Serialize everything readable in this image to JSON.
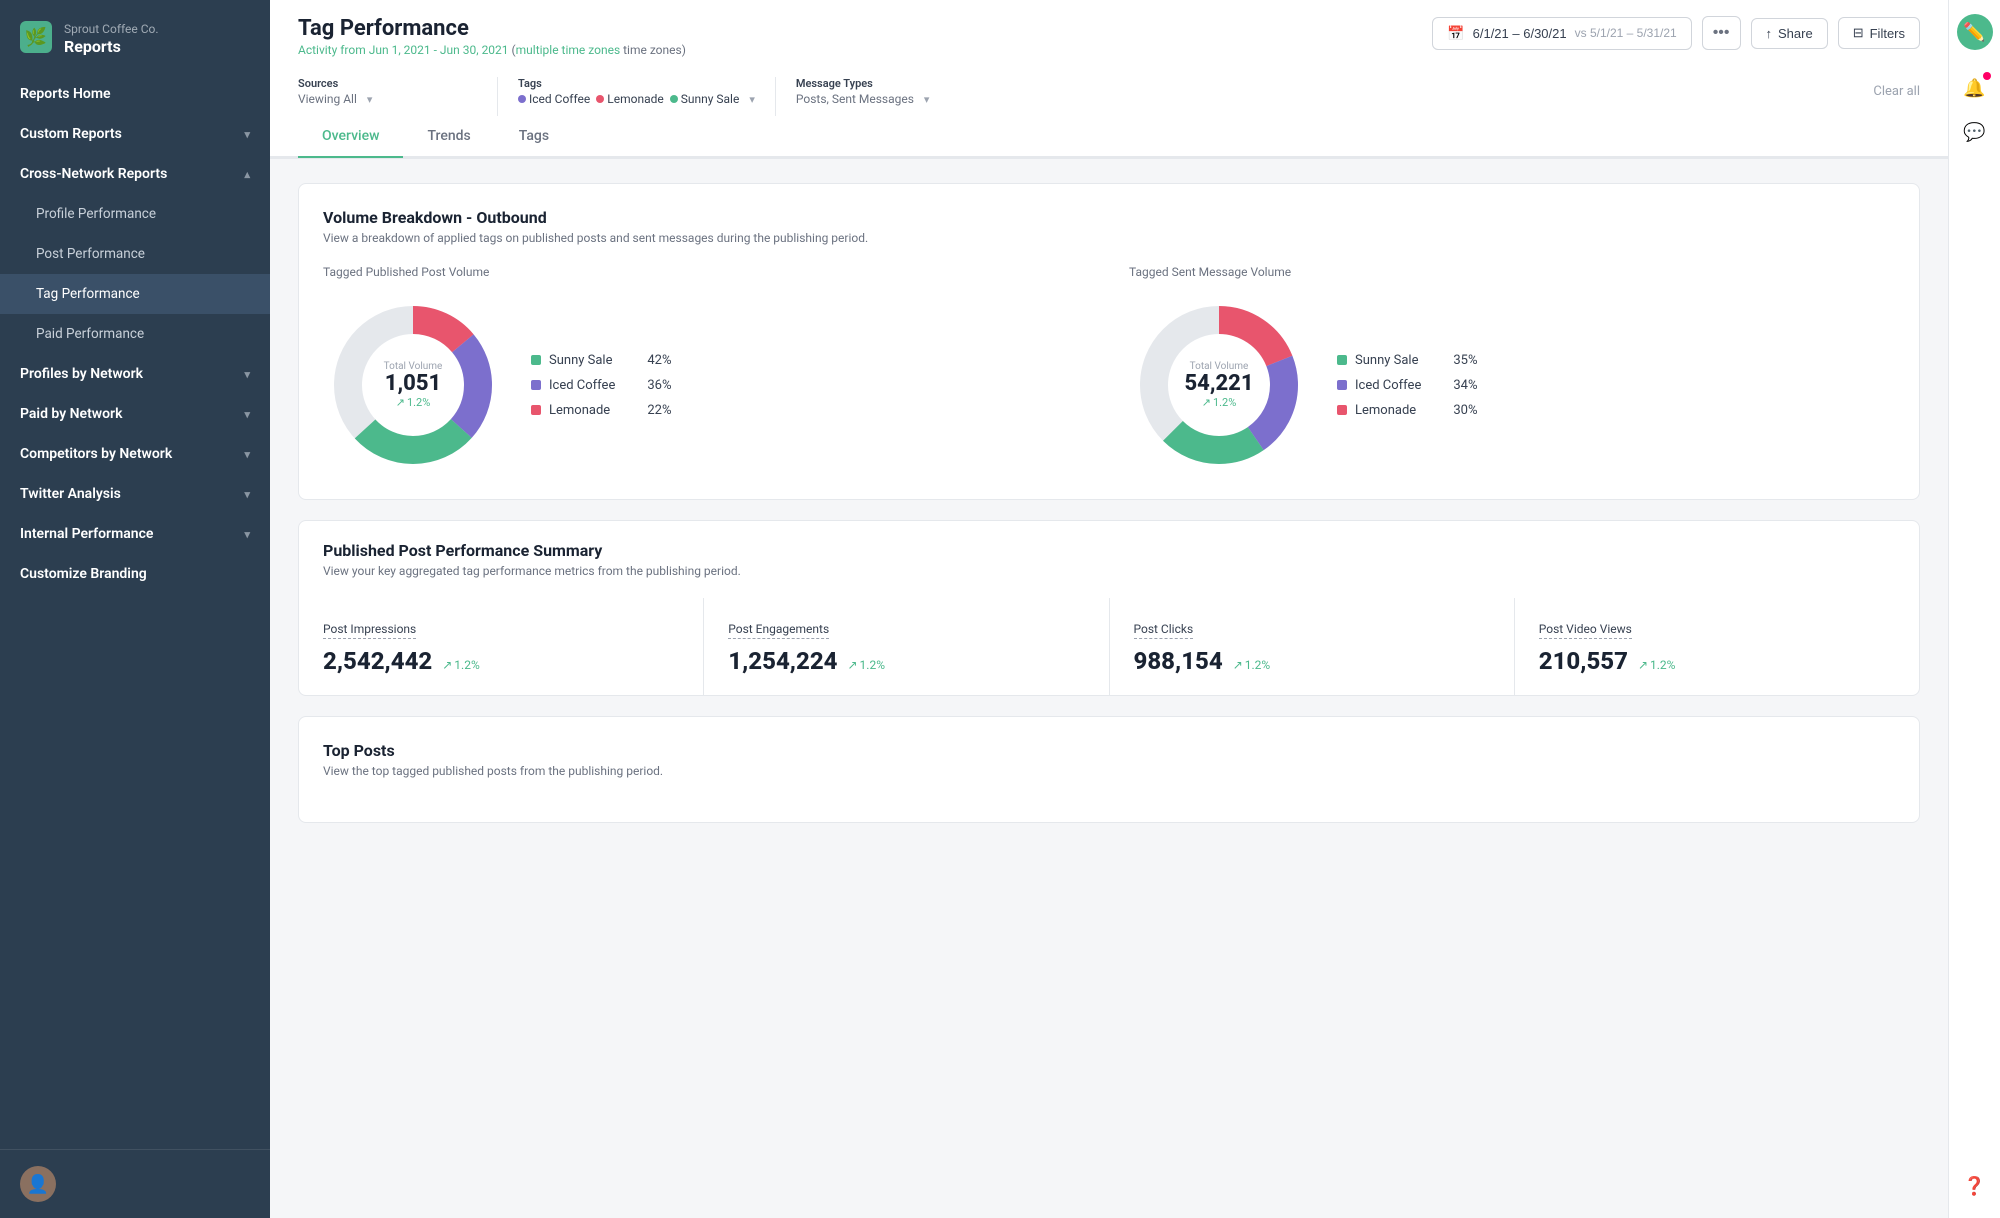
{
  "brand": {
    "company": "Sprout Coffee Co.",
    "app": "Reports"
  },
  "sidebar": {
    "nav": [
      {
        "id": "reports-home",
        "label": "Reports Home",
        "level": "top",
        "active": false
      },
      {
        "id": "custom-reports",
        "label": "Custom Reports",
        "level": "top",
        "hasChevron": true,
        "active": false
      },
      {
        "id": "cross-network",
        "label": "Cross-Network Reports",
        "level": "top",
        "hasChevron": true,
        "expanded": true,
        "active": false
      },
      {
        "id": "profile-performance",
        "label": "Profile Performance",
        "level": "sub",
        "active": false
      },
      {
        "id": "post-performance",
        "label": "Post Performance",
        "level": "sub",
        "active": false
      },
      {
        "id": "tag-performance",
        "label": "Tag Performance",
        "level": "sub",
        "active": true
      },
      {
        "id": "paid-performance",
        "label": "Paid Performance",
        "level": "sub",
        "active": false
      },
      {
        "id": "profiles-by-network",
        "label": "Profiles by Network",
        "level": "top",
        "hasChevron": true,
        "active": false
      },
      {
        "id": "paid-by-network",
        "label": "Paid by Network",
        "level": "top",
        "hasChevron": true,
        "active": false
      },
      {
        "id": "competitors-by-network",
        "label": "Competitors by Network",
        "level": "top",
        "hasChevron": true,
        "active": false
      },
      {
        "id": "twitter-analysis",
        "label": "Twitter Analysis",
        "level": "top",
        "hasChevron": true,
        "active": false
      },
      {
        "id": "internal-performance",
        "label": "Internal Performance",
        "level": "top",
        "hasChevron": true,
        "active": false
      },
      {
        "id": "customize-branding",
        "label": "Customize Branding",
        "level": "top",
        "active": false
      }
    ]
  },
  "header": {
    "title": "Tag Performance",
    "subtitle": "Activity from Jun 1, 2021 - Jun 30, 2021",
    "timezoneNote": "multiple time zones",
    "dateRange": "6/1/21 – 6/30/21",
    "compareRange": "vs 5/1/21 – 5/31/21",
    "actions": {
      "share": "Share",
      "filters": "Filters"
    }
  },
  "filtersBar": {
    "sources": {
      "label": "Sources",
      "value": "Viewing All"
    },
    "tags": {
      "label": "Tags",
      "items": [
        {
          "name": "Iced Coffee",
          "color": "#7c6fcd"
        },
        {
          "name": "Lemonade",
          "color": "#e8556d"
        },
        {
          "name": "Sunny Sale",
          "color": "#4cb98c"
        }
      ]
    },
    "messageTypes": {
      "label": "Message Types",
      "value": "Posts, Sent Messages"
    },
    "clearAll": "Clear all"
  },
  "tabs": [
    {
      "id": "overview",
      "label": "Overview",
      "active": true
    },
    {
      "id": "trends",
      "label": "Trends",
      "active": false
    },
    {
      "id": "tags",
      "label": "Tags",
      "active": false
    }
  ],
  "volumeBreakdown": {
    "title": "Volume Breakdown - Outbound",
    "subtitle": "View a breakdown of applied tags on published posts and sent messages during the publishing period.",
    "publishedChart": {
      "label": "Tagged Published Post Volume",
      "totalLabel": "Total Volume",
      "totalValue": "1,051",
      "change": "1.2%",
      "segments": [
        {
          "label": "Sunny Sale",
          "color": "#4cb98c",
          "pct": 42,
          "degrees": 151.2
        },
        {
          "label": "Iced Coffee",
          "color": "#7c6fcd",
          "pct": 36,
          "degrees": 129.6
        },
        {
          "label": "Lemonade",
          "color": "#e8556d",
          "pct": 22,
          "degrees": 79.2
        }
      ]
    },
    "sentChart": {
      "label": "Tagged Sent Message Volume",
      "totalLabel": "Total Volume",
      "totalValue": "54,221",
      "change": "1.2%",
      "segments": [
        {
          "label": "Sunny Sale",
          "color": "#4cb98c",
          "pct": 35,
          "degrees": 126
        },
        {
          "label": "Iced Coffee",
          "color": "#7c6fcd",
          "pct": 34,
          "degrees": 122.4
        },
        {
          "label": "Lemonade",
          "color": "#e8556d",
          "pct": 30,
          "degrees": 108
        }
      ]
    }
  },
  "postPerformance": {
    "title": "Published Post Performance Summary",
    "subtitle": "View your key aggregated tag performance metrics from the publishing period.",
    "stats": [
      {
        "id": "post-impressions",
        "label": "Post Impressions",
        "value": "2,542,442",
        "change": "1.2%"
      },
      {
        "id": "post-engagements",
        "label": "Post Engagements",
        "value": "1,254,224",
        "change": "1.2%"
      },
      {
        "id": "post-clicks",
        "label": "Post Clicks",
        "value": "988,154",
        "change": "1.2%"
      },
      {
        "id": "post-video-views",
        "label": "Post Video Views",
        "value": "210,557",
        "change": "1.2%"
      }
    ]
  },
  "topPosts": {
    "title": "Top Posts",
    "subtitle": "View the top tagged published posts from the publishing period."
  },
  "colors": {
    "sunnySale": "#4cb98c",
    "icedCoffee": "#7c6fcd",
    "lemonade": "#e8556d",
    "accent": "#4cb98c",
    "sidebarBg": "#2c3e50"
  }
}
